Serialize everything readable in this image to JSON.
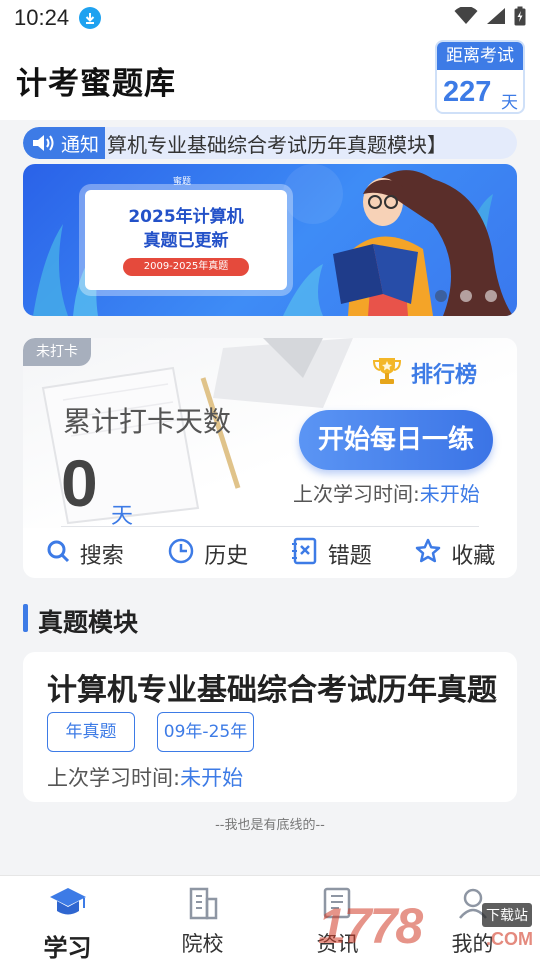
{
  "status_bar": {
    "time": "10:24"
  },
  "header": {
    "title": "计考蜜题库",
    "countdown": {
      "label": "距离考试",
      "days": "227",
      "unit": "天"
    }
  },
  "notice": {
    "badge": "通知",
    "text": "算机专业基础综合考试历年真题模块】"
  },
  "banner": {
    "brand": "蜜题",
    "title_line1": "2025年计算机",
    "title_line2": "真题已更新",
    "tag": "2009-2025年真题",
    "slide_count": 3,
    "active_slide": 1
  },
  "checkin": {
    "status_tag": "未打卡",
    "ranking_label": "排行榜",
    "total_label": "累计打卡天数",
    "days": "0",
    "days_unit": "天",
    "start_button": "开始每日一练",
    "last_study_label": "上次学习时间:",
    "last_study_value": "未开始",
    "tools": [
      {
        "label": "搜索",
        "icon": "search-icon"
      },
      {
        "label": "历史",
        "icon": "history-icon"
      },
      {
        "label": "错题",
        "icon": "wrong-questions-icon"
      },
      {
        "label": "收藏",
        "icon": "star-icon"
      }
    ]
  },
  "section": {
    "title": "真题模块"
  },
  "module": {
    "title": "计算机专业基础综合考试历年真题",
    "chips": [
      "年真题",
      "09年-25年"
    ],
    "last_study_label": "上次学习时间:",
    "last_study_value": "未开始"
  },
  "footer_note": "--我也是有底线的--",
  "tabs": [
    {
      "label": "学习",
      "icon": "graduation-cap-icon",
      "active": true
    },
    {
      "label": "院校",
      "icon": "building-icon",
      "active": false
    },
    {
      "label": "资讯",
      "icon": "news-icon",
      "active": false
    },
    {
      "label": "我的",
      "icon": "user-icon",
      "active": false
    }
  ],
  "watermark": {
    "text": "1778",
    "tag": "下载站",
    "suffix": ".COM"
  },
  "colors": {
    "accent": "#3d7be6",
    "tag_gray": "#a7afbd",
    "banner_red": "#e54a3c"
  }
}
